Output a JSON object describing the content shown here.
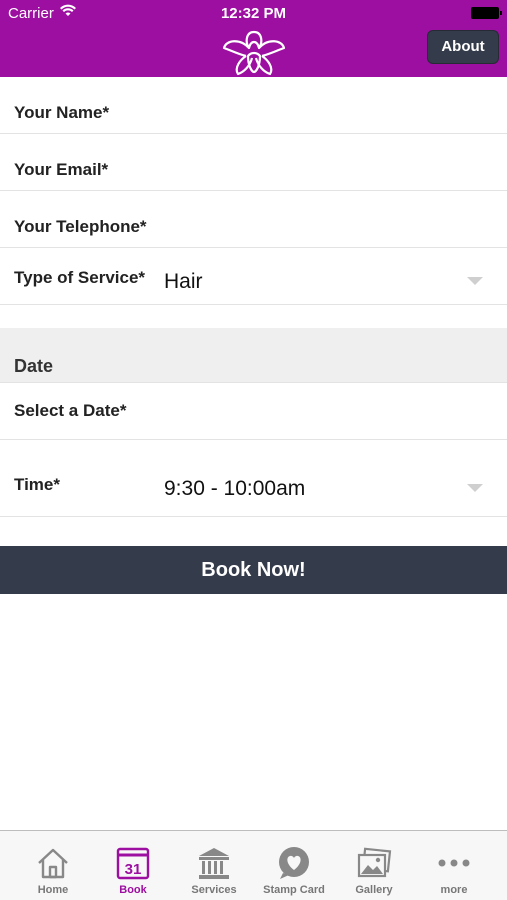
{
  "status_bar": {
    "carrier": "Carrier",
    "time": "12:32 PM"
  },
  "header": {
    "logo_icon": "orchid-logo-icon",
    "about_label": "About",
    "brand_color": "#9c0fa0"
  },
  "form": {
    "name_label": "Your Name*",
    "email_label": "Your Email*",
    "telephone_label": "Your Telephone*",
    "service_label": "Type of Service*",
    "service_value": "Hair",
    "date_section_title": "Date",
    "date_label": "Select a Date*",
    "time_label": "Time*",
    "time_value": "9:30 - 10:00am"
  },
  "book_button": {
    "label": "Book Now!",
    "color": "#343b4a"
  },
  "tabbar": {
    "items": [
      {
        "label": "Home",
        "icon": "home-icon"
      },
      {
        "label": "Book",
        "icon": "calendar-icon",
        "badge": "31",
        "active": true
      },
      {
        "label": "Services",
        "icon": "bank-icon"
      },
      {
        "label": "Stamp Card",
        "icon": "heart-bubble-icon"
      },
      {
        "label": "Gallery",
        "icon": "photos-icon"
      },
      {
        "label": "more",
        "icon": "more-dots-icon"
      }
    ]
  }
}
